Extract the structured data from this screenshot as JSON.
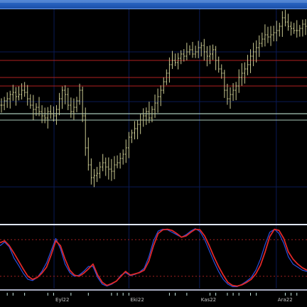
{
  "window": {
    "title": ""
  },
  "colors": {
    "background": "#000000",
    "price_bars": "#c8c890",
    "resistance_lines": "#b02020",
    "support_line": "#a8c8b8",
    "grid": "#0a1a55",
    "stoch_k": "#e02828",
    "stoch_d": "#2850e0",
    "stoch_levels": "#a02020",
    "date_labels": "#c8c8c8",
    "volume_ticks": "#c8e8e0"
  },
  "chart_data": [
    {
      "type": "ohlc",
      "pane": "price",
      "bars_count": 115,
      "ylim": [
        0,
        100
      ],
      "closes": [
        55,
        57,
        58,
        60,
        61,
        59,
        60,
        62,
        61,
        58,
        55,
        53,
        54,
        52,
        50,
        49,
        52,
        51,
        50,
        53,
        58,
        62,
        60,
        55,
        52,
        54,
        57,
        62,
        50,
        35,
        27,
        21,
        22,
        23,
        26,
        28,
        26,
        25,
        24,
        27,
        28,
        30,
        32,
        35,
        40,
        42,
        44,
        46,
        48,
        50,
        52,
        49,
        53,
        56,
        59,
        62,
        66,
        70,
        74,
        76,
        75,
        77,
        79,
        78,
        80,
        81,
        79,
        80,
        82,
        83,
        80,
        78,
        79,
        81,
        76,
        72,
        70,
        62,
        58,
        60,
        62,
        64,
        68,
        70,
        72,
        74,
        78,
        80,
        82,
        84,
        86,
        88,
        87,
        88,
        89,
        90,
        92,
        96,
        94,
        92,
        91,
        90,
        90,
        91,
        93,
        92
      ],
      "resistance_levels": [
        76,
        68,
        64
      ],
      "support_level": 51
    },
    {
      "type": "line",
      "pane": "stochastic",
      "ylim": [
        0,
        100
      ],
      "levels": [
        80,
        20
      ],
      "series": [
        {
          "name": "",
          "color": "#e02828",
          "values": [
            75,
            78,
            70,
            58,
            45,
            32,
            20,
            15,
            18,
            25,
            35,
            55,
            78,
            70,
            48,
            30,
            22,
            20,
            25,
            32,
            40,
            22,
            10,
            5,
            8,
            12,
            20,
            28,
            22,
            24,
            26,
            30,
            45,
            70,
            90,
            96,
            97,
            95,
            90,
            84,
            86,
            92,
            97,
            96,
            86,
            70,
            52,
            36,
            22,
            10,
            5,
            4,
            6,
            10,
            15,
            24,
            38,
            60,
            85,
            97,
            95,
            82,
            60,
            48,
            40,
            34,
            30
          ]
        },
        {
          "name": "",
          "color": "#2850e0",
          "values": [
            70,
            76,
            68,
            50,
            38,
            25,
            15,
            13,
            18,
            28,
            42,
            62,
            82,
            65,
            40,
            26,
            20,
            22,
            28,
            36,
            36,
            18,
            7,
            4,
            7,
            12,
            22,
            26,
            21,
            23,
            27,
            33,
            52,
            78,
            94,
            97,
            96,
            92,
            88,
            84,
            88,
            94,
            98,
            93,
            80,
            62,
            44,
            28,
            15,
            7,
            3,
            3,
            7,
            12,
            18,
            30,
            48,
            72,
            92,
            97,
            90,
            74,
            52,
            40,
            35,
            30,
            28
          ]
        }
      ]
    }
  ],
  "x_axis": {
    "labels": [
      {
        "text": "Eyl22",
        "pos": 0.176
      },
      {
        "text": "Eki22",
        "pos": 0.42
      },
      {
        "text": "Kas22",
        "pos": 0.65
      },
      {
        "text": "Ara22",
        "pos": 0.9
      }
    ]
  }
}
